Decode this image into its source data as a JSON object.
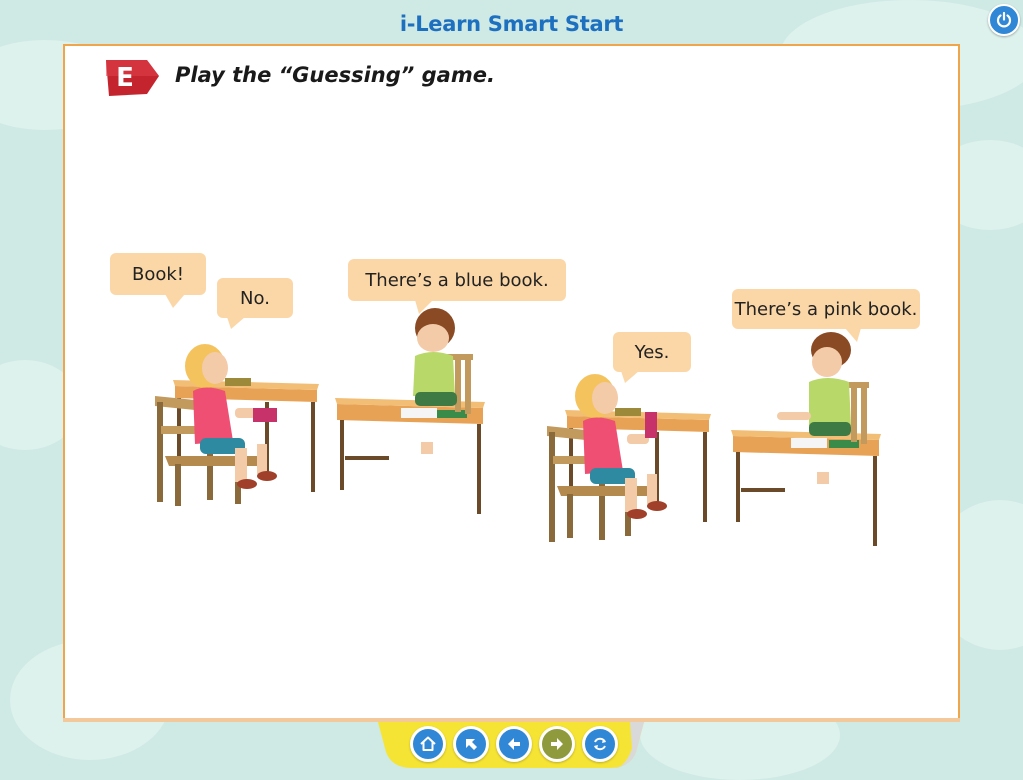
{
  "app": {
    "title": "i-Learn Smart Start"
  },
  "header": {
    "power_icon": "power-icon"
  },
  "activity": {
    "badge_letter": "E",
    "instruction": "Play the “Guessing” game."
  },
  "bubbles": [
    {
      "text": "Book!"
    },
    {
      "text": "No."
    },
    {
      "text": "There’s a blue book."
    },
    {
      "text": "Yes."
    },
    {
      "text": "There’s a pink book."
    }
  ],
  "nav": {
    "buttons": [
      {
        "icon": "home-icon",
        "color": "#2f87d6"
      },
      {
        "icon": "arrow-up-left-icon",
        "color": "#2f87d6"
      },
      {
        "icon": "arrow-left-icon",
        "color": "#2f87d6"
      },
      {
        "icon": "arrow-right-icon",
        "color": "#8e9a3c"
      },
      {
        "icon": "refresh-icon",
        "color": "#2f87d6"
      }
    ]
  },
  "colors": {
    "background": "#cfe9e4",
    "panel_border": "#f0a54a",
    "bubble": "#fbd7a7",
    "badge": "#d8303a",
    "title": "#1d6fc0",
    "nav_bar": "#f6e434"
  }
}
